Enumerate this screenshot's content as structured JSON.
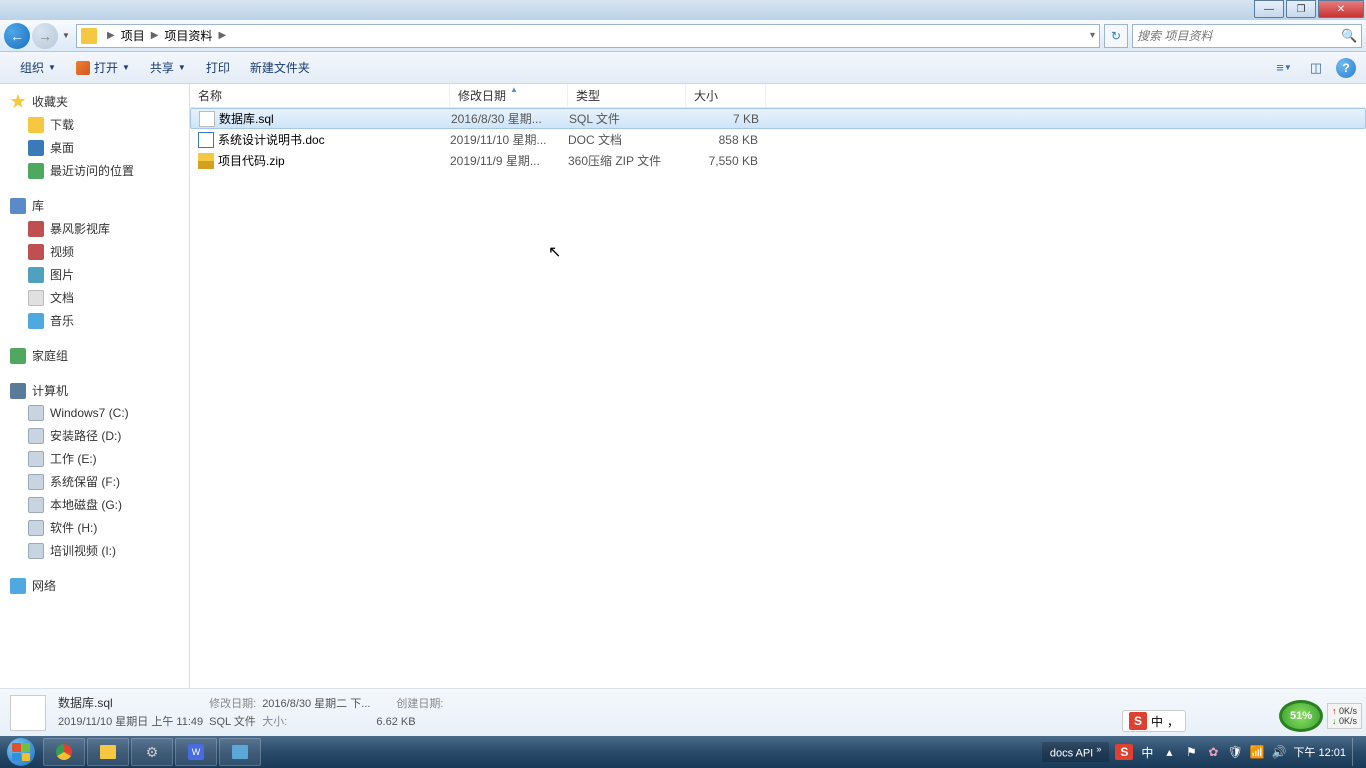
{
  "titlebar": {
    "min": "—",
    "max": "❐",
    "close": "✕"
  },
  "nav": {
    "crumb1": "项目",
    "crumb2": "项目资料",
    "search_placeholder": "搜索 项目资料",
    "refresh": "↻"
  },
  "toolbar": {
    "organize": "组织",
    "open": "打开",
    "share": "共享",
    "print": "打印",
    "newfolder": "新建文件夹",
    "help": "?"
  },
  "sidebar": {
    "favorites": "收藏夹",
    "downloads": "下载",
    "desktop": "桌面",
    "recent": "最近访问的位置",
    "libraries": "库",
    "storm": "暴风影视库",
    "videos": "视频",
    "pictures": "图片",
    "documents": "文档",
    "music": "音乐",
    "homegroup": "家庭组",
    "computer": "计算机",
    "drive_c": "Windows7 (C:)",
    "drive_d": "安装路径 (D:)",
    "drive_e": "工作 (E:)",
    "drive_f": "系统保留 (F:)",
    "drive_g": "本地磁盘 (G:)",
    "drive_h": "软件 (H:)",
    "drive_i": "培训视频 (I:)",
    "network": "网络"
  },
  "columns": {
    "name": "名称",
    "date": "修改日期",
    "type": "类型",
    "size": "大小",
    "sort": "▲"
  },
  "files": [
    {
      "name": "数据库.sql",
      "date": "2016/8/30 星期...",
      "type": "SQL 文件",
      "size": "7 KB",
      "icon": "i-sql",
      "selected": true
    },
    {
      "name": "系统设计说明书.doc",
      "date": "2019/11/10 星期...",
      "type": "DOC 文档",
      "size": "858 KB",
      "icon": "i-docfile",
      "selected": false
    },
    {
      "name": "项目代码.zip",
      "date": "2019/11/9 星期...",
      "type": "360压缩 ZIP 文件",
      "size": "7,550 KB",
      "icon": "i-zip",
      "selected": false
    }
  ],
  "details": {
    "filename": "数据库.sql",
    "filetype": "SQL 文件",
    "moddate_label": "修改日期:",
    "moddate": "2016/8/30 星期二 下...",
    "size_label": "大小:",
    "size": "6.62 KB",
    "created_label": "创建日期:",
    "created": "2019/11/10 星期日 上午 11:49"
  },
  "taskbar": {
    "docapi": "docs API",
    "ime": "中",
    "clock": "下午 12:01"
  },
  "float": {
    "battery": "51%",
    "netup": "0K/s",
    "netdown": "0K/s",
    "sogou": "S",
    "sogou_text": "中",
    "sogou_punct": "，"
  }
}
